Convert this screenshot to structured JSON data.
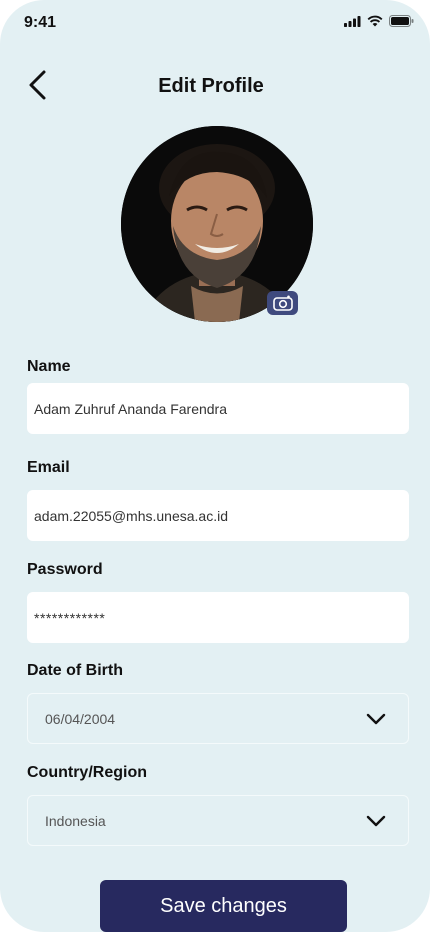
{
  "status_bar": {
    "time": "9:41"
  },
  "header": {
    "title": "Edit Profile"
  },
  "form": {
    "name": {
      "label": "Name",
      "value": "Adam Zuhruf Ananda Farendra"
    },
    "email": {
      "label": "Email",
      "value": "adam.22055@mhs.unesa.ac.id"
    },
    "password": {
      "label": "Password",
      "value": "************"
    },
    "dob": {
      "label": "Date of Birth",
      "value": "06/04/2004"
    },
    "country": {
      "label": "Country/Region",
      "value": "Indonesia"
    }
  },
  "actions": {
    "save_label": "Save changes"
  },
  "colors": {
    "background": "#e3f0f3",
    "primary": "#27295f",
    "camera_badge": "#3f4a7e"
  },
  "icons": [
    "signal-icon",
    "wifi-icon",
    "battery-icon",
    "back-arrow-icon",
    "camera-icon",
    "chevron-down-icon"
  ]
}
